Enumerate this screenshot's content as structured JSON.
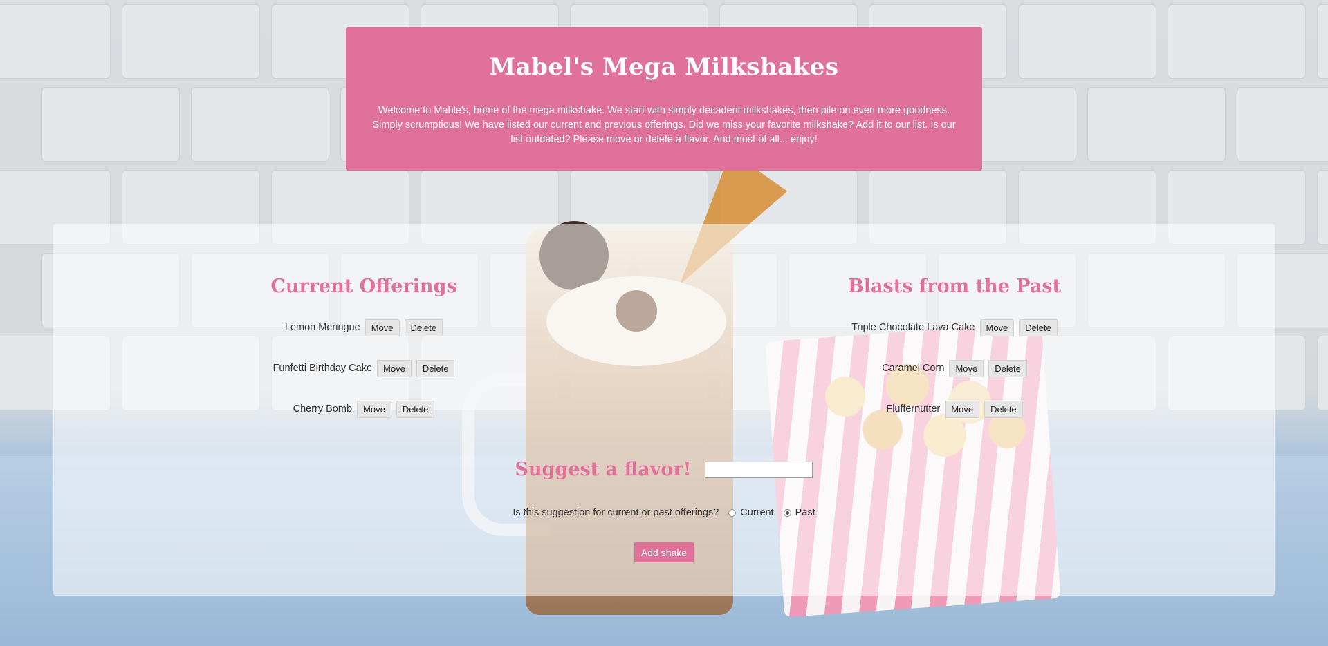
{
  "header": {
    "title": "Mabel's Mega Milkshakes",
    "intro": "Welcome to Mable's, home of the mega milkshake. We start with simply decadent milkshakes, then pile on even more goodness. Simply scrumptious! We have listed our current and previous offerings. Did we miss your favorite milkshake? Add it to our list. Is our list outdated? Please move or delete a flavor. And most of all... enjoy!"
  },
  "current": {
    "heading": "Current Offerings",
    "items": [
      {
        "name": "Lemon Meringue"
      },
      {
        "name": "Funfetti Birthday Cake"
      },
      {
        "name": "Cherry Bomb"
      }
    ]
  },
  "past": {
    "heading": "Blasts from the Past",
    "items": [
      {
        "name": "Triple Chocolate Lava Cake"
      },
      {
        "name": "Caramel Corn"
      },
      {
        "name": "Fluffernutter"
      }
    ]
  },
  "buttons": {
    "move": "Move",
    "delete": "Delete",
    "add": "Add shake"
  },
  "suggest": {
    "heading": "Suggest a flavor!",
    "input_value": "",
    "question": "Is this suggestion for current or past offerings?",
    "option_current": "Current",
    "option_past": "Past",
    "selected": "Past"
  },
  "colors": {
    "accent": "#e0719a"
  }
}
